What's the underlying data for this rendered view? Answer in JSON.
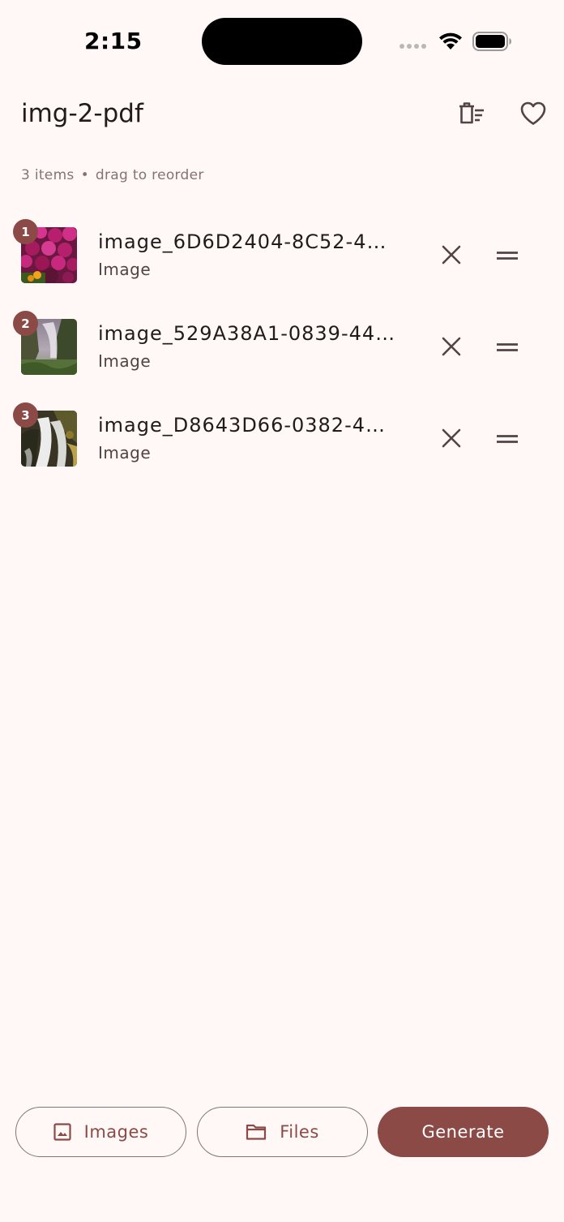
{
  "status_bar": {
    "time": "2:15"
  },
  "app_bar": {
    "title": "img-2-pdf",
    "actions": [
      "clear-all-icon",
      "heart-icon"
    ]
  },
  "subtitle": {
    "count": "3 items",
    "separator": "•",
    "hint": "drag to reorder"
  },
  "items": [
    {
      "index": "1",
      "name": "image_6D6D2404-8C52-4…",
      "type": "Image",
      "thumb": "flowers"
    },
    {
      "index": "2",
      "name": "image_529A38A1-0839-44…",
      "type": "Image",
      "thumb": "waterfall"
    },
    {
      "index": "3",
      "name": "image_D8643D66-0382-4…",
      "type": "Image",
      "thumb": "cascade"
    }
  ],
  "bottom_bar": {
    "images_label": "Images",
    "files_label": "Files",
    "generate_label": "Generate"
  },
  "colors": {
    "background": "#fff8f6",
    "primary": "#8c4a47",
    "outline": "#857371",
    "on_surface": "#231a19"
  }
}
